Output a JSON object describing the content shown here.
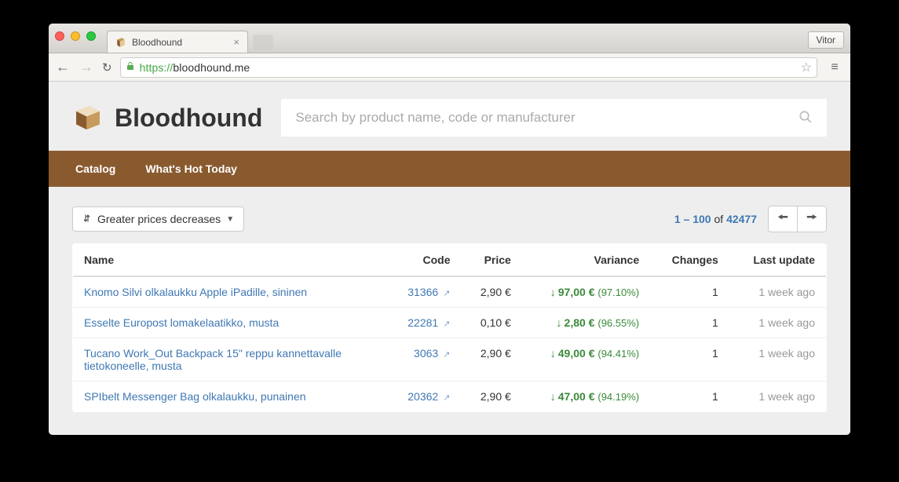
{
  "browser": {
    "tab_title": "Bloodhound",
    "user_label": "Vitor",
    "url_protocol": "https://",
    "url_host": "bloodhound.me"
  },
  "brand": {
    "name": "Bloodhound"
  },
  "search": {
    "placeholder": "Search by product name, code or manufacturer"
  },
  "nav": {
    "items": [
      "Catalog",
      "What's Hot Today"
    ]
  },
  "sort": {
    "label": "Greater prices decreases"
  },
  "pagination": {
    "range": "1 – 100",
    "of_label": "of",
    "total": "42477"
  },
  "table": {
    "headers": {
      "name": "Name",
      "code": "Code",
      "price": "Price",
      "variance": "Variance",
      "changes": "Changes",
      "last_update": "Last update"
    },
    "rows": [
      {
        "name": "Knomo Silvi olkalaukku Apple iPadille, sininen",
        "code": "31366",
        "price": "2,90 €",
        "variance_value": "97,00 €",
        "variance_pct": "(97.10%)",
        "changes": "1",
        "last_update": "1 week ago"
      },
      {
        "name": "Esselte Europost lomakelaatikko, musta",
        "code": "22281",
        "price": "0,10 €",
        "variance_value": "2,80 €",
        "variance_pct": "(96.55%)",
        "changes": "1",
        "last_update": "1 week ago"
      },
      {
        "name": "Tucano Work_Out Backpack 15\" reppu kannettavalle tietokoneelle, musta",
        "code": "3063",
        "price": "2,90 €",
        "variance_value": "49,00 €",
        "variance_pct": "(94.41%)",
        "changes": "1",
        "last_update": "1 week ago"
      },
      {
        "name": "SPIbelt Messenger Bag olkalaukku, punainen",
        "code": "20362",
        "price": "2,90 €",
        "variance_value": "47,00 €",
        "variance_pct": "(94.19%)",
        "changes": "1",
        "last_update": "1 week ago"
      }
    ]
  }
}
